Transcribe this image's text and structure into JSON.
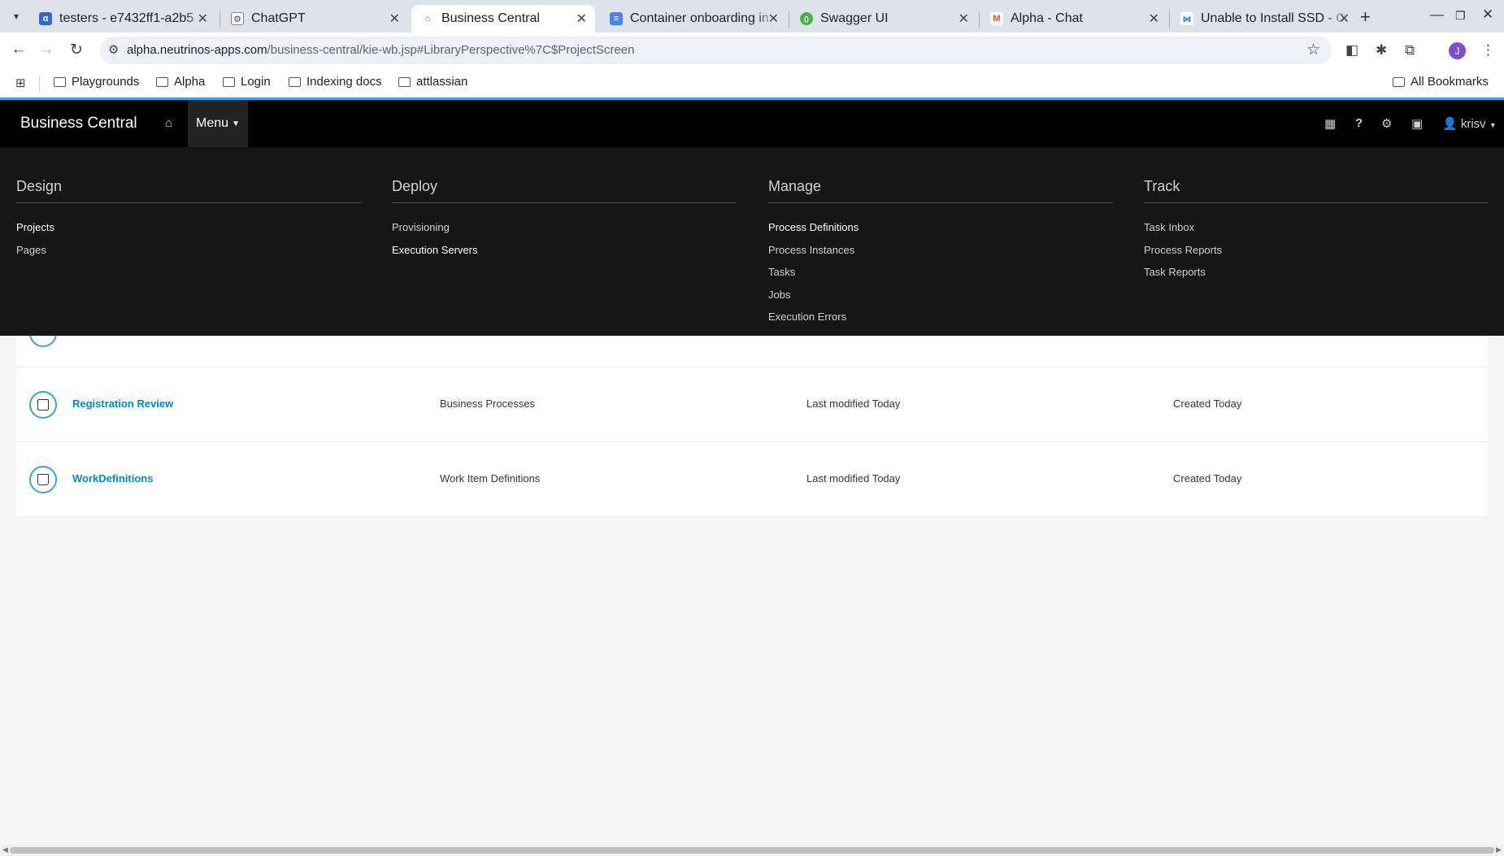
{
  "browser": {
    "tabs": [
      {
        "title": "testers - e7432ff1-a2b5",
        "favicon_color": "#3367d6",
        "favicon_glyph": "α"
      },
      {
        "title": "ChatGPT",
        "favicon_color": "#444444",
        "favicon_glyph": "⚙"
      },
      {
        "title": "Business Central",
        "favicon_color": "#ffffff",
        "favicon_glyph": "⌂",
        "active": true
      },
      {
        "title": "Container onboarding in",
        "favicon_color": "#4285f4",
        "favicon_glyph": "≡"
      },
      {
        "title": "Swagger UI",
        "favicon_color": "#49b04e",
        "favicon_glyph": "{}"
      },
      {
        "title": "Alpha - Chat",
        "favicon_color": "#ea4335",
        "favicon_glyph": "M"
      },
      {
        "title": "Unable to Install SSD - C",
        "favicon_color": "#1e6ed8",
        "favicon_glyph": "⋈"
      }
    ],
    "close_glyph": "✕",
    "new_tab_glyph": "+",
    "url_host": "alpha.neutrinos-apps.com",
    "url_path": "/business-central/kie-wb.jsp#LibraryPerspective%7C$ProjectScreen",
    "profile_initial": "J",
    "bookmarks": [
      "Playgrounds",
      "Alpha",
      "Login",
      "Indexing docs",
      "attlassian"
    ],
    "all_bookmarks": "All Bookmarks"
  },
  "app": {
    "brand": "Business Central",
    "menu_label": "Menu",
    "user_name": "krisv",
    "accent_color": "#39a5dc",
    "link_color": "#0088ce"
  },
  "mega_menu": [
    {
      "heading": "Design",
      "items": [
        {
          "label": "Projects",
          "strong": true
        },
        {
          "label": "Pages"
        }
      ]
    },
    {
      "heading": "Deploy",
      "items": [
        {
          "label": "Provisioning"
        },
        {
          "label": "Execution Servers",
          "strong": true
        }
      ]
    },
    {
      "heading": "Manage",
      "items": [
        {
          "label": "Process Definitions",
          "strong": true
        },
        {
          "label": "Process Instances"
        },
        {
          "label": "Tasks"
        },
        {
          "label": "Jobs"
        },
        {
          "label": "Execution Errors"
        }
      ]
    },
    {
      "heading": "Track",
      "items": [
        {
          "label": "Task Inbox"
        },
        {
          "label": "Process Reports"
        },
        {
          "label": "Task Reports"
        }
      ]
    }
  ],
  "assets": [
    {
      "name": "Registration Review",
      "type": "Business Processes",
      "modified": "Last modified Today",
      "created": "Created Today"
    },
    {
      "name": "WorkDefinitions",
      "type": "Work Item Definitions",
      "modified": "Last modified Today",
      "created": "Created Today"
    }
  ]
}
